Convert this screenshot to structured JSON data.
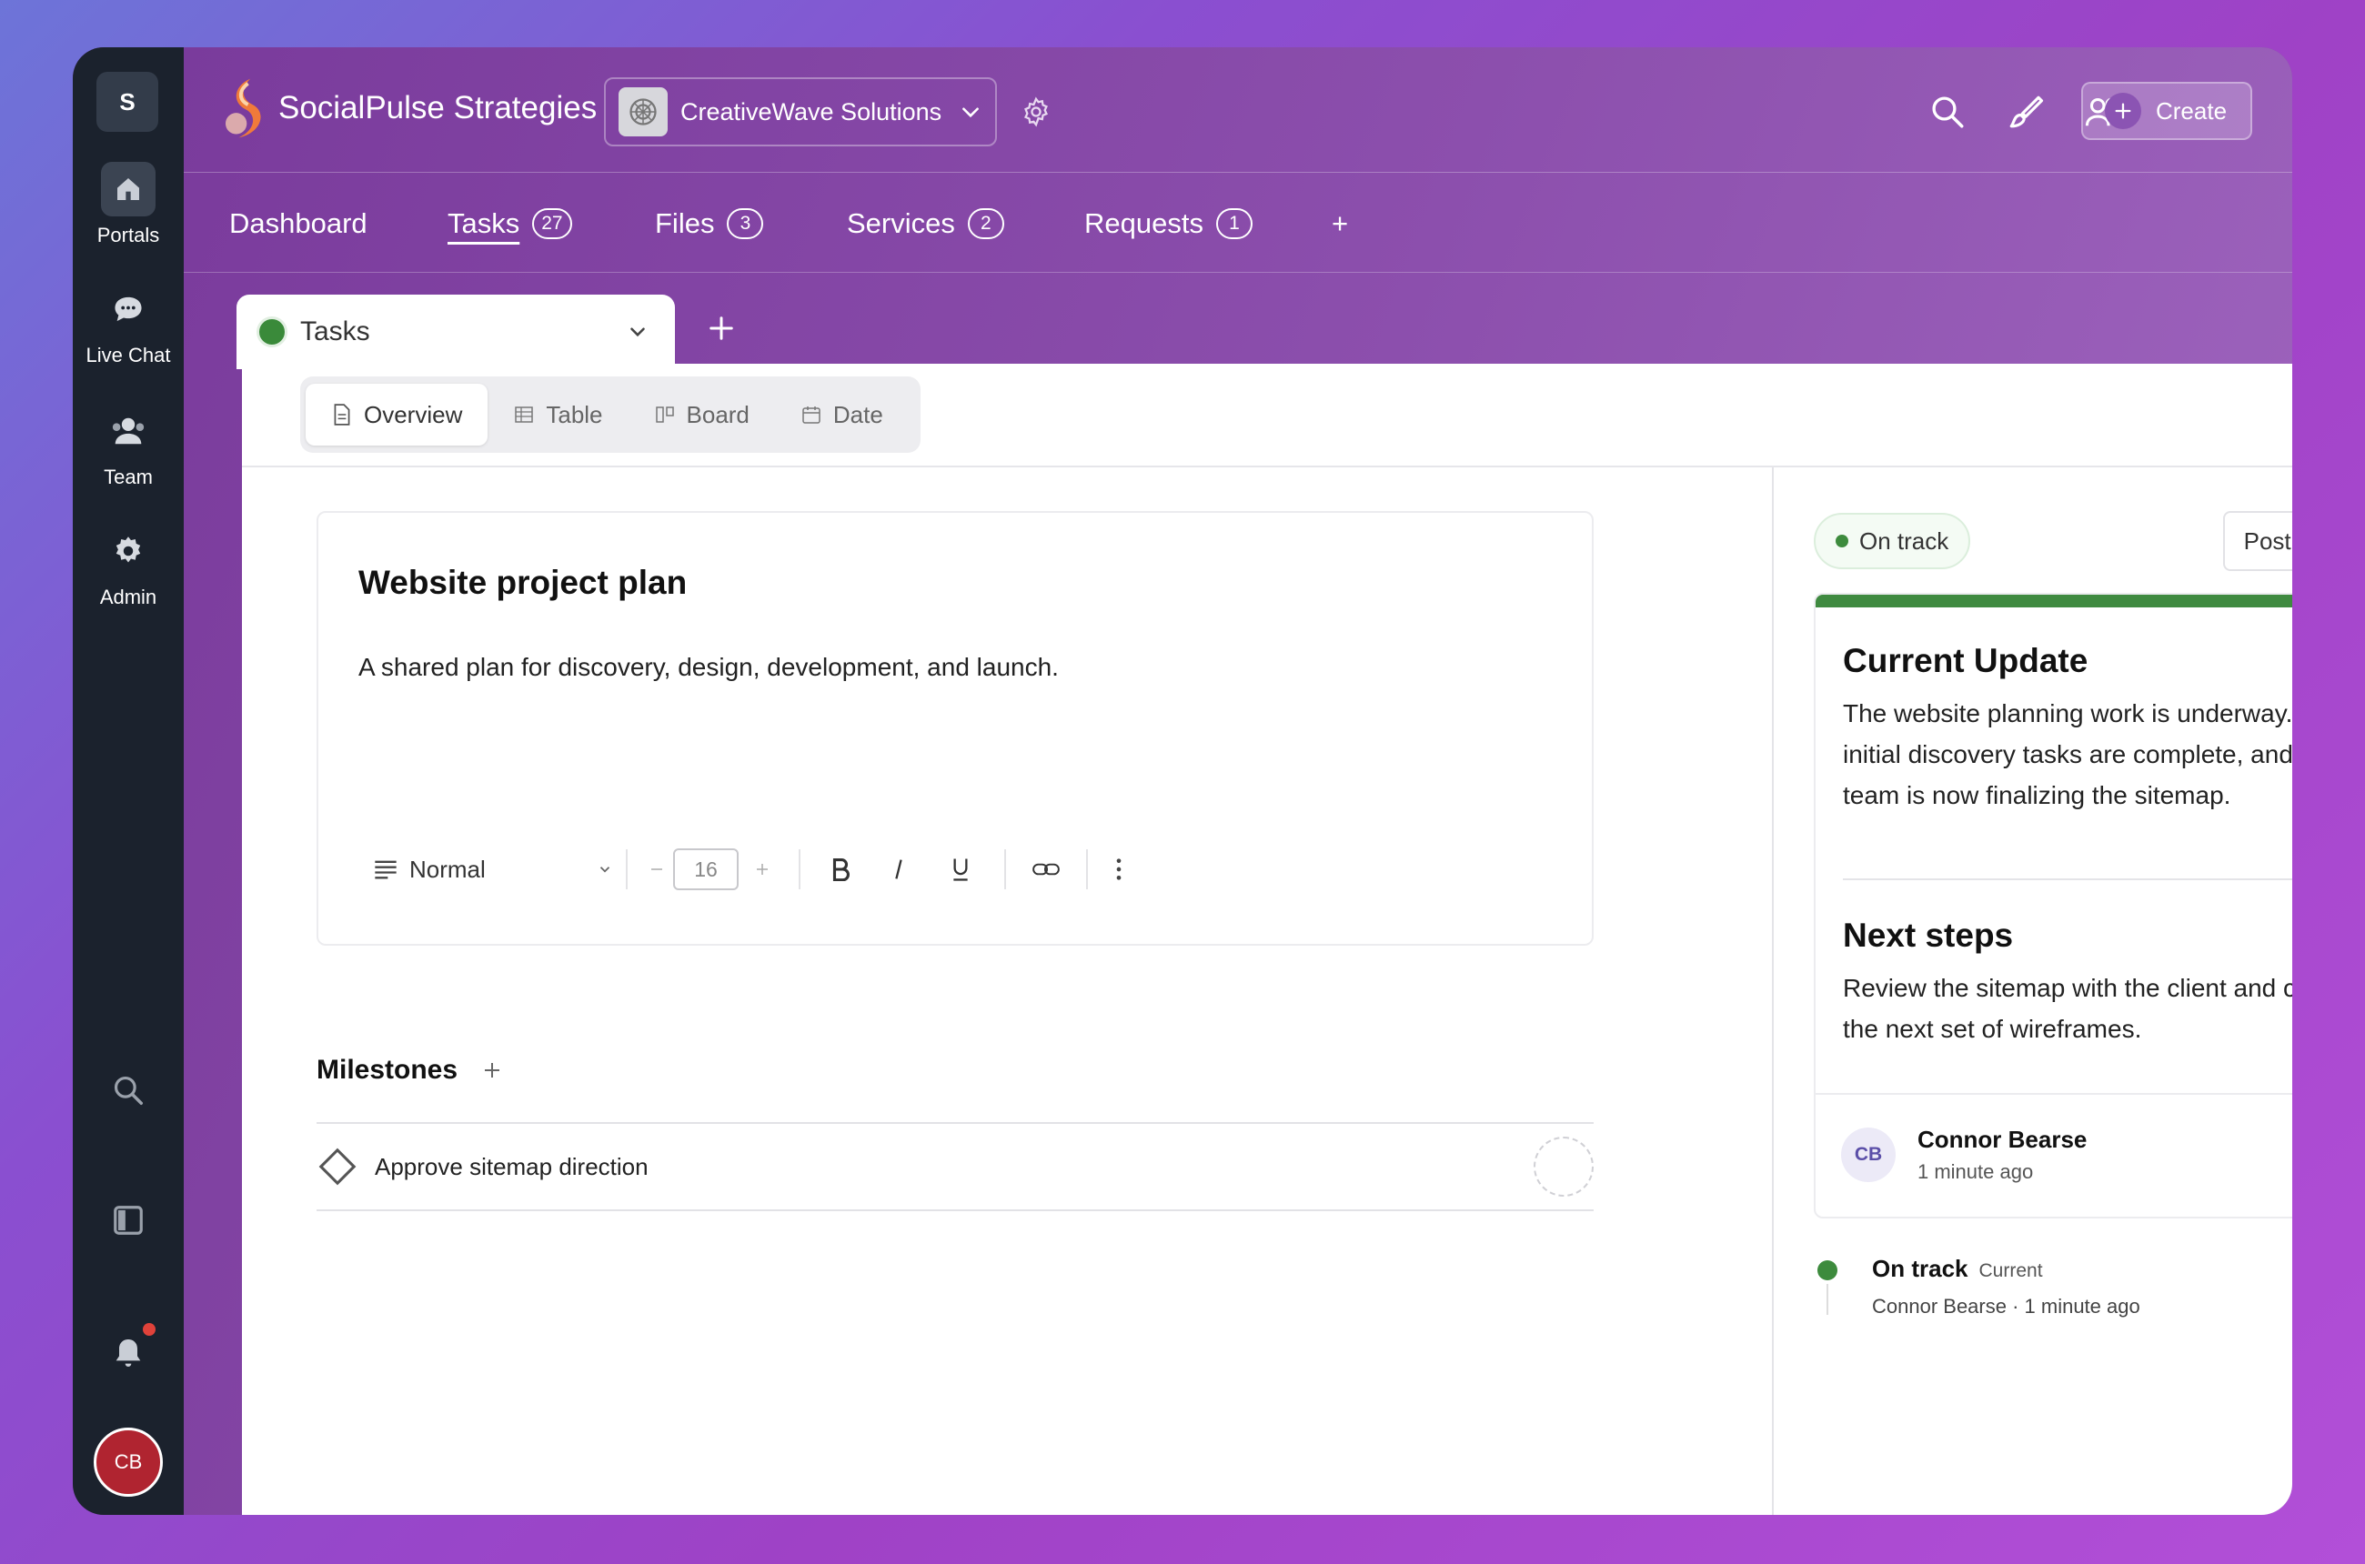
{
  "sidebar": {
    "workspace_initial": "S",
    "items": [
      {
        "label": "Portals",
        "icon": "home-icon"
      },
      {
        "label": "Live Chat",
        "icon": "chat-icon"
      },
      {
        "label": "Team",
        "icon": "team-icon"
      },
      {
        "label": "Admin",
        "icon": "gear-icon"
      }
    ],
    "bottom_icons": [
      "search-icon",
      "panel-toggle-icon",
      "bell-icon"
    ],
    "user_initials": "CB"
  },
  "header": {
    "brand": "SocialPulse Strategies",
    "client": "CreativeWave Solutions",
    "create_label": "Create"
  },
  "nav": {
    "tabs": [
      {
        "label": "Dashboard",
        "count": null
      },
      {
        "label": "Tasks",
        "count": "27"
      },
      {
        "label": "Files",
        "count": "3"
      },
      {
        "label": "Services",
        "count": "2"
      },
      {
        "label": "Requests",
        "count": "1"
      }
    ],
    "add_label": "+"
  },
  "view": {
    "name": "Tasks",
    "status_color": "#3a8a3a",
    "subtabs": [
      "Overview",
      "Table",
      "Board",
      "Date"
    ],
    "active_subtab": "Overview"
  },
  "doc": {
    "title": "Website project plan",
    "description": "A shared plan for discovery, design, development, and launch.",
    "toolbar": {
      "style": "Normal",
      "font_size": "16"
    }
  },
  "milestones": {
    "heading": "Milestones",
    "items": [
      {
        "label": "Approve sitemap direction"
      }
    ]
  },
  "update": {
    "status": "On track",
    "status_color": "#3d8b3d",
    "post_label": "Post update",
    "current_heading": "Current Update",
    "current_text": "The website planning work is underway. The initial discovery tasks are complete, and the team is now finalizing the sitemap.",
    "next_heading": "Next steps",
    "next_text": "Review the sitemap with the client and confirm the next set of wireframes.",
    "author_initials": "CB",
    "author": "Connor Bearse",
    "time": "1 minute ago"
  },
  "history": {
    "status": "On track",
    "tag": "Current",
    "meta": "Connor Bearse · 1 minute ago"
  }
}
